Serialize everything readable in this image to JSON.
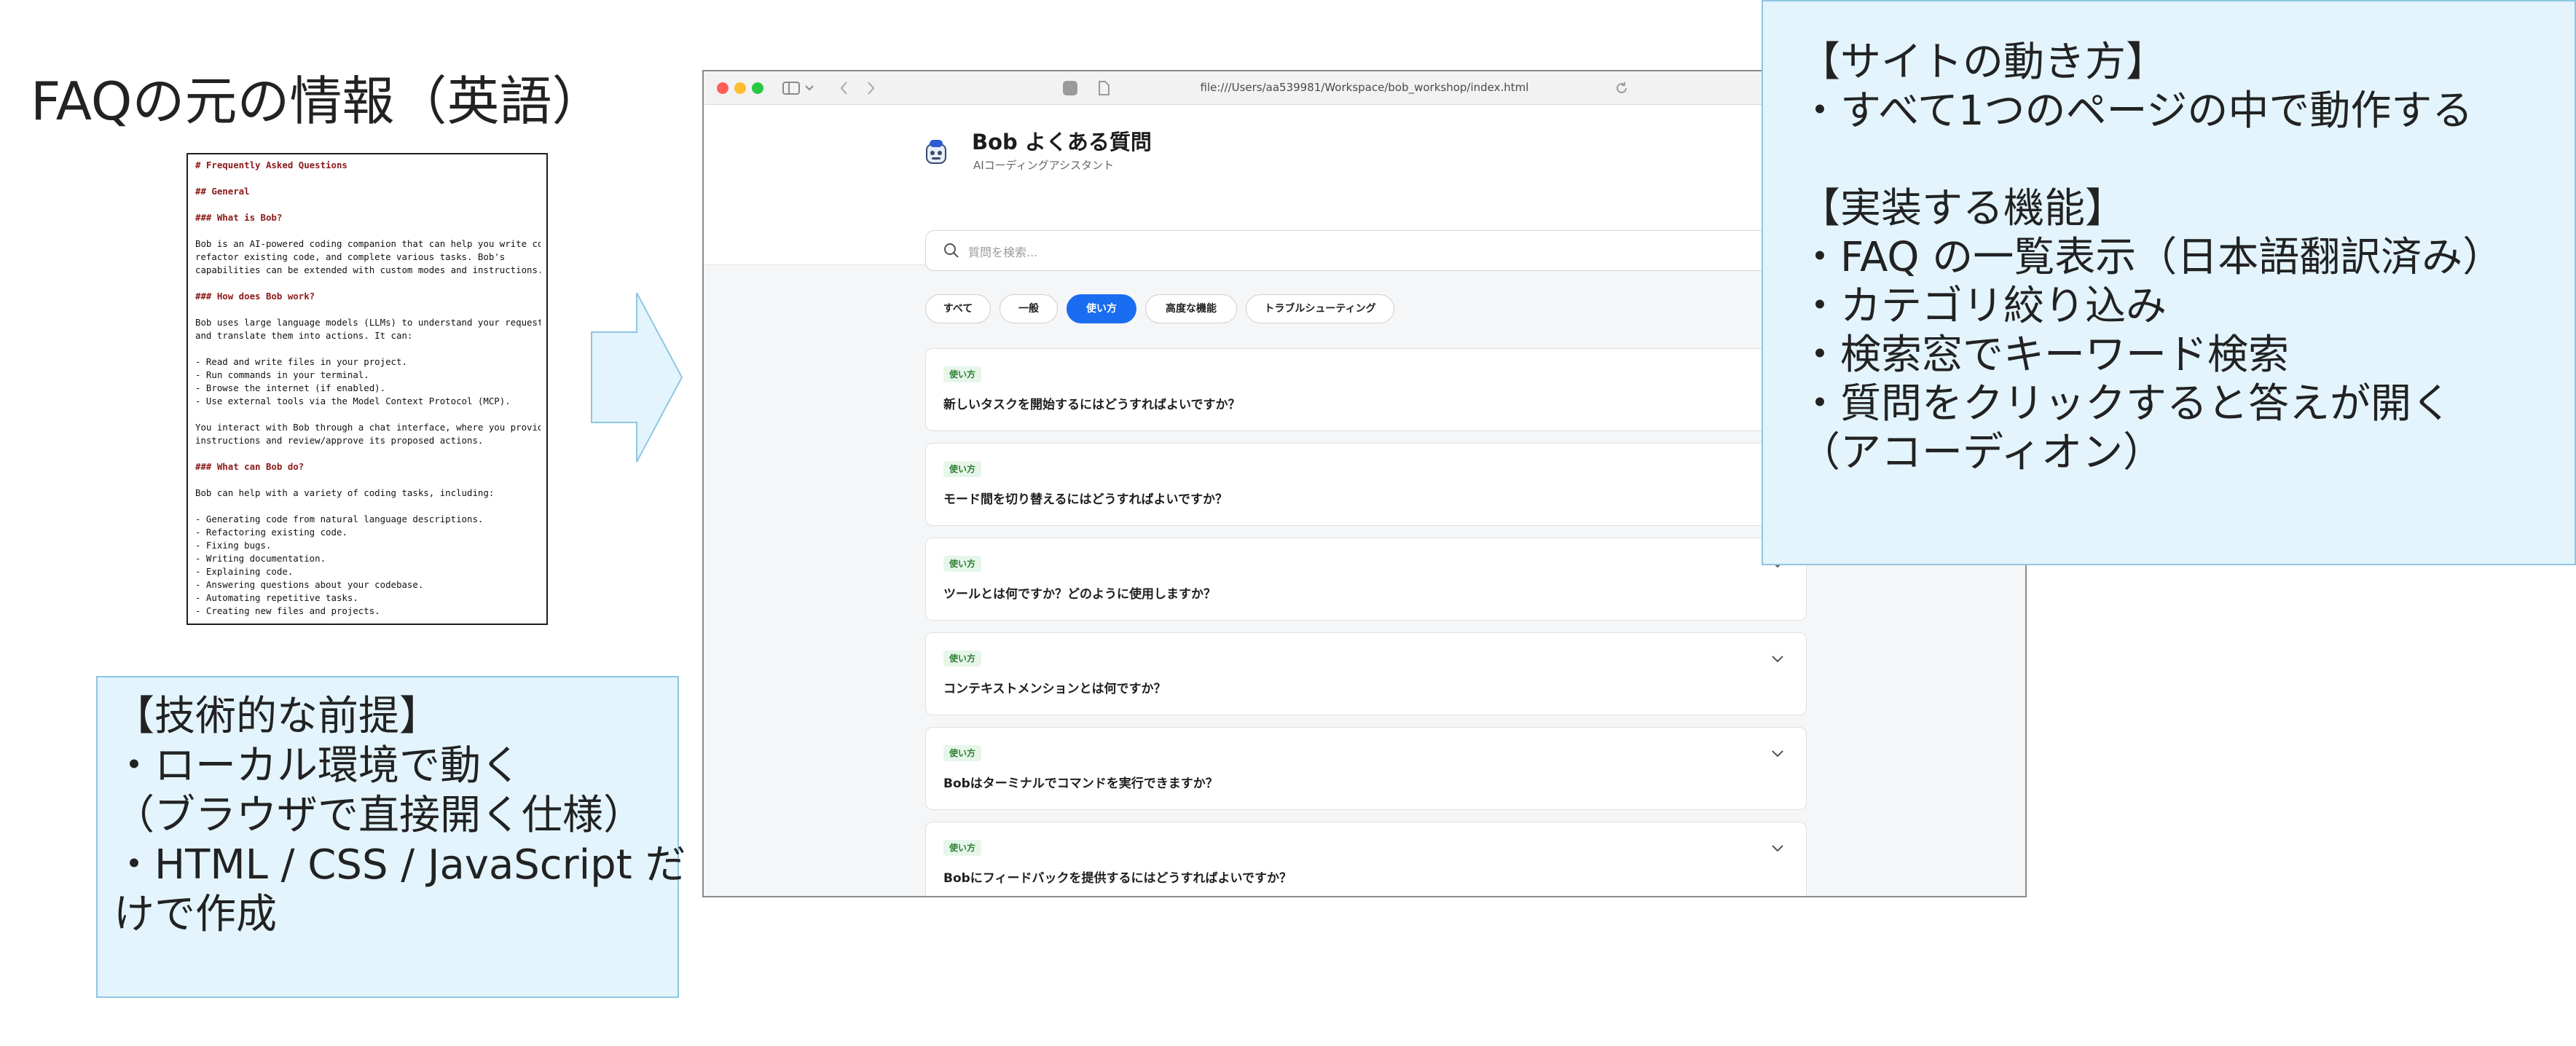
{
  "left_title": "FAQの元の情報（英語）",
  "markdown_lines": [
    {
      "t": "# Frequently Asked Questions",
      "h": true
    },
    {
      "t": "",
      "h": false
    },
    {
      "t": "## General",
      "h": true
    },
    {
      "t": "",
      "h": false
    },
    {
      "t": "### What is Bob?",
      "h": true
    },
    {
      "t": "",
      "h": false
    },
    {
      "t": "Bob is an AI-powered coding companion that can help you write code,",
      "h": false
    },
    {
      "t": "refactor existing code, and complete various tasks. Bob's",
      "h": false
    },
    {
      "t": "capabilities can be extended with custom modes and instructions.",
      "h": false
    },
    {
      "t": "",
      "h": false
    },
    {
      "t": "### How does Bob work?",
      "h": true
    },
    {
      "t": "",
      "h": false
    },
    {
      "t": "Bob uses large language models (LLMs) to understand your requests",
      "h": false
    },
    {
      "t": "and translate them into actions. It can:",
      "h": false
    },
    {
      "t": "",
      "h": false
    },
    {
      "t": "- Read and write files in your project.",
      "h": false
    },
    {
      "t": "- Run commands in your terminal.",
      "h": false
    },
    {
      "t": "- Browse the internet (if enabled).",
      "h": false
    },
    {
      "t": "- Use external tools via the Model Context Protocol (MCP).",
      "h": false
    },
    {
      "t": "",
      "h": false
    },
    {
      "t": "You interact with Bob through a chat interface, where you provide",
      "h": false
    },
    {
      "t": "instructions and review/approve its proposed actions.",
      "h": false
    },
    {
      "t": "",
      "h": false
    },
    {
      "t": "### What can Bob do?",
      "h": true
    },
    {
      "t": "",
      "h": false
    },
    {
      "t": "Bob can help with a variety of coding tasks, including:",
      "h": false
    },
    {
      "t": "",
      "h": false
    },
    {
      "t": "- Generating code from natural language descriptions.",
      "h": false
    },
    {
      "t": "- Refactoring existing code.",
      "h": false
    },
    {
      "t": "- Fixing bugs.",
      "h": false
    },
    {
      "t": "- Writing documentation.",
      "h": false
    },
    {
      "t": "- Explaining code.",
      "h": false
    },
    {
      "t": "- Answering questions about your codebase.",
      "h": false
    },
    {
      "t": "- Automating repetitive tasks.",
      "h": false
    },
    {
      "t": "- Creating new files and projects.",
      "h": false
    }
  ],
  "tech_box": {
    "lines": [
      "【技術的な前提】",
      "・ローカル環境で動く",
      "（ブラウザで直接開く仕様）",
      "・HTML / CSS / JavaScript だ",
      "けで作成"
    ]
  },
  "browser": {
    "url": "file:///Users/aa539981/Workspace/bob_workshop/index.html",
    "site_title": "Bob よくある質問",
    "site_subtitle": "AIコーディングアシスタント",
    "search_placeholder": "質問を検索...",
    "categories": [
      {
        "label": "すべて",
        "active": false
      },
      {
        "label": "一般",
        "active": false
      },
      {
        "label": "使い方",
        "active": true
      },
      {
        "label": "高度な機能",
        "active": false
      },
      {
        "label": "トラブルシューティング",
        "active": false
      }
    ],
    "faqs": [
      {
        "tag": "使い方",
        "question": "新しいタスクを開始するにはどうすればよいですか？"
      },
      {
        "tag": "使い方",
        "question": "モード間を切り替えるにはどうすればよいですか？"
      },
      {
        "tag": "使い方",
        "question": "ツールとは何ですか？どのように使用しますか？"
      },
      {
        "tag": "使い方",
        "question": "コンテキストメンションとは何ですか？"
      },
      {
        "tag": "使い方",
        "question": "Bobはターミナルでコマンドを実行できますか？"
      },
      {
        "tag": "使い方",
        "question": "Bobにフィードバックを提供するにはどうすればよいですか？"
      }
    ]
  },
  "features_box": {
    "lines": [
      "【サイトの動き方】",
      "・すべて1つのページの中で動作する",
      "",
      "【実装する機能】",
      "・FAQ の一覧表示（日本語翻訳済み）",
      "・カテゴリ絞り込み",
      "・検索窓でキーワード検索",
      "・質問をクリックすると答えが開く",
      "（アコーディオン）"
    ]
  },
  "colors": {
    "accent_blue": "#1a6cf0",
    "info_box_bg": "#e3f4fd",
    "info_box_border": "#8ec6e3",
    "tag_green": "#2e7d32",
    "md_heading": "#8b1a1a"
  }
}
